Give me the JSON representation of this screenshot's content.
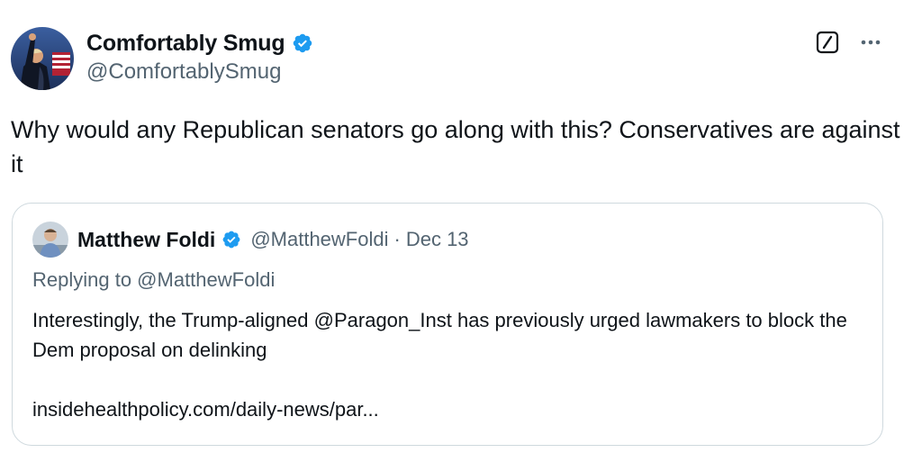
{
  "author": {
    "display_name": "Comfortably Smug",
    "handle": "@ComfortablySmug",
    "verified": true,
    "avatar_icon": "avatar-photo"
  },
  "actions": {
    "grok_icon": "grok-icon",
    "more_icon": "more-icon"
  },
  "post": {
    "text": "Why would any Republican senators go along with this? Conservatives are against it"
  },
  "quoted_post": {
    "display_name": "Matthew Foldi",
    "handle": "@MatthewFoldi",
    "separator": "·",
    "date": "Dec 13",
    "verified": true,
    "replying_to": "Replying to @MatthewFoldi",
    "text": "Interestingly, the Trump-aligned @Paragon_Inst has previously urged lawmakers to block the Dem proposal on delinking",
    "link": "insidehealthpolicy.com/daily-news/par..."
  },
  "colors": {
    "verified_blue": "#1d9bf0",
    "text_primary": "#0f1419",
    "text_secondary": "#536471",
    "border": "#cfd9de"
  }
}
